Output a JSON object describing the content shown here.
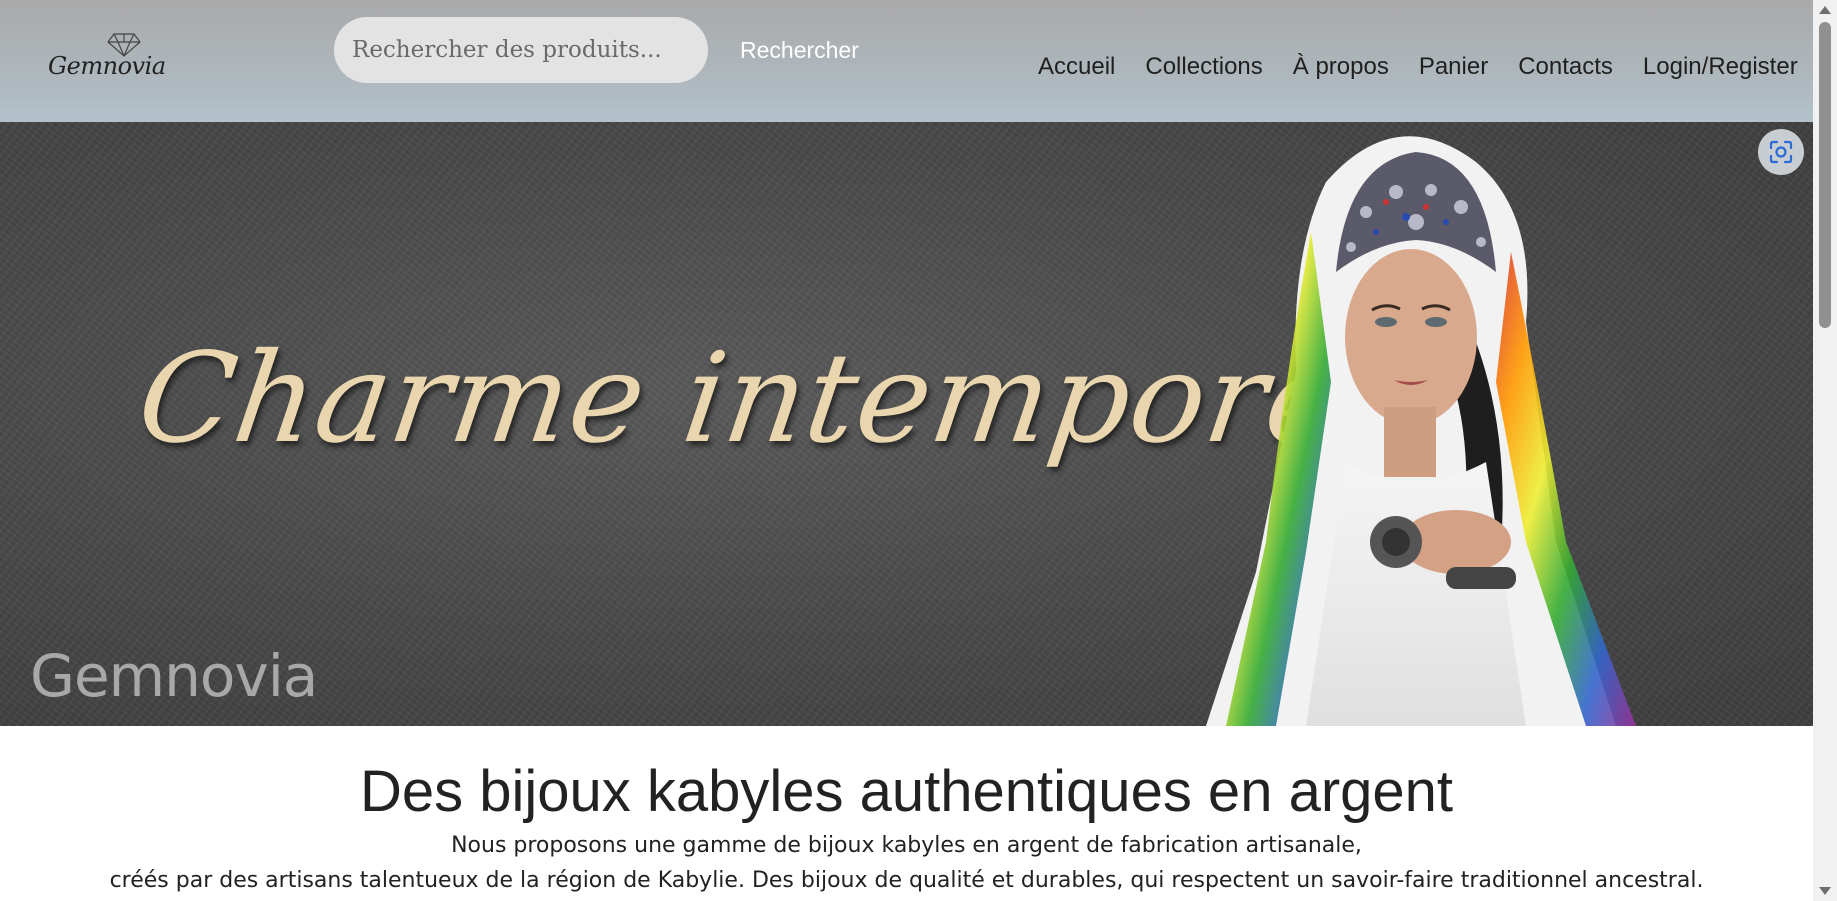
{
  "header": {
    "logo_text": "Gemnovia",
    "search": {
      "placeholder": "Rechercher des produits...",
      "button_label": "Rechercher"
    },
    "nav": [
      {
        "label": "Accueil"
      },
      {
        "label": "Collections"
      },
      {
        "label": "À propos"
      },
      {
        "label": "Panier"
      },
      {
        "label": "Contacts"
      },
      {
        "label": "Login/Register"
      }
    ]
  },
  "hero": {
    "title": "Charme intemporel",
    "watermark": "Gemnovia",
    "screenshot_icon": "screenshot-icon"
  },
  "intro": {
    "title": "Des bijoux kabyles authentiques en argent",
    "line1": "Nous proposons une gamme de bijoux kabyles en argent de fabrication artisanale,",
    "line2": "créés par des artisans talentueux de la région de Kabylie. Des bijoux de qualité et durables, qui respectent un savoir-faire traditionnel ancestral."
  },
  "colors": {
    "header_gradient_top": "#a9a9aa",
    "header_gradient_bottom": "#b3c3cb",
    "hero_title": "#e9d6ae",
    "hero_background": "#4a4a4a",
    "search_field": "#e3e3e3"
  }
}
